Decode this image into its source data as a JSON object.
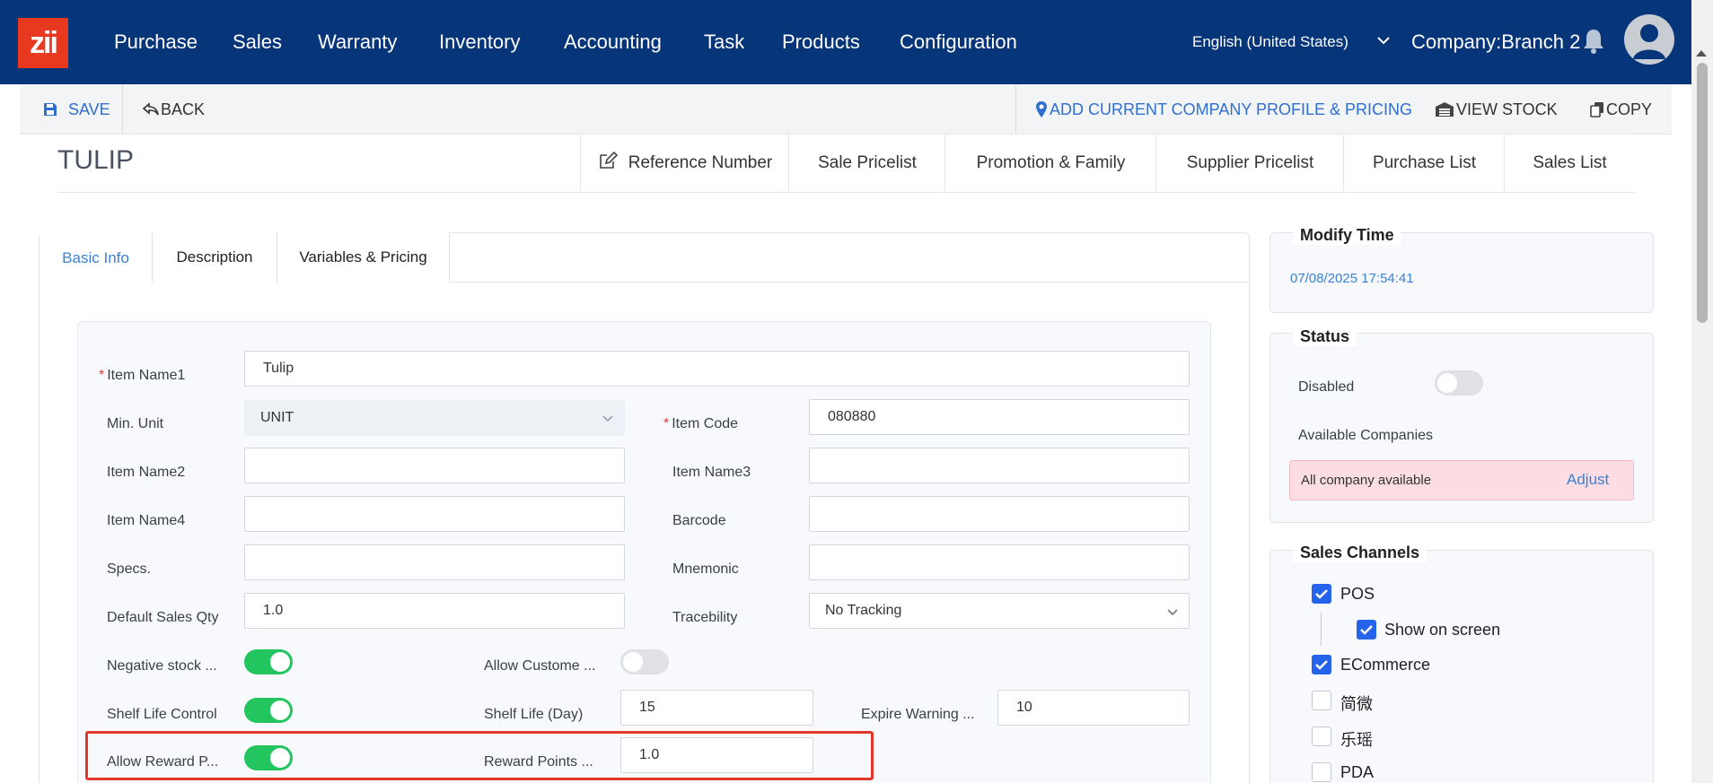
{
  "nav": {
    "logo": "zii",
    "items": [
      "Purchase",
      "Sales",
      "Warranty",
      "Inventory",
      "Accounting",
      "Task",
      "Products",
      "Configuration"
    ],
    "language": "English (United States)",
    "company": "Company:Branch 2"
  },
  "toolbar": {
    "save": "SAVE",
    "back": "BACK",
    "add_profile": "ADD CURRENT COMPANY PROFILE & PRICING",
    "view_stock": "VIEW STOCK",
    "copy": "COPY"
  },
  "page": {
    "title": "TULIP",
    "right_tabs": [
      "Reference Number",
      "Sale Pricelist",
      "Promotion & Family",
      "Supplier Pricelist",
      "Purchase List",
      "Sales List"
    ]
  },
  "tabs": [
    "Basic Info",
    "Description",
    "Variables & Pricing"
  ],
  "form": {
    "item_name1": {
      "label": "Item Name1",
      "value": "Tulip"
    },
    "min_unit": {
      "label": "Min. Unit",
      "value": "UNIT"
    },
    "item_code": {
      "label": "Item Code",
      "value": "080880"
    },
    "item_name2": {
      "label": "Item Name2",
      "value": ""
    },
    "item_name3": {
      "label": "Item Name3",
      "value": ""
    },
    "item_name4": {
      "label": "Item Name4",
      "value": ""
    },
    "barcode": {
      "label": "Barcode",
      "value": ""
    },
    "specs": {
      "label": "Specs.",
      "value": ""
    },
    "mnemonic": {
      "label": "Mnemonic",
      "value": ""
    },
    "default_sales_qty": {
      "label": "Default Sales Qty",
      "value": "1.0"
    },
    "traceability": {
      "label": "Tracebility",
      "value": "No Tracking"
    },
    "negative_stock": {
      "label": "Negative stock ...",
      "on": true
    },
    "allow_customer": {
      "label": "Allow Custome ...",
      "on": false
    },
    "shelf_life_control": {
      "label": "Shelf Life Control",
      "on": true
    },
    "shelf_life_day": {
      "label": "Shelf Life (Day)",
      "value": "15"
    },
    "expire_warning": {
      "label": "Expire Warning ...",
      "value": "10"
    },
    "allow_reward": {
      "label": "Allow Reward P...",
      "on": true
    },
    "reward_points": {
      "label": "Reward Points ...",
      "value": "1.0"
    }
  },
  "modify_time": {
    "title": "Modify Time",
    "value": "07/08/2025 17:54:41"
  },
  "status": {
    "title": "Status",
    "disabled_label": "Disabled",
    "disabled_on": false,
    "available_label": "Available Companies",
    "available_text": "All company available",
    "adjust": "Adjust"
  },
  "sales_channels": {
    "title": "Sales Channels",
    "items": [
      {
        "label": "POS",
        "checked": true
      },
      {
        "label": "Show on screen",
        "checked": true
      },
      {
        "label": "ECommerce",
        "checked": true
      },
      {
        "label": "简微",
        "checked": false
      },
      {
        "label": "乐瑶",
        "checked": false
      },
      {
        "label": "PDA",
        "checked": false
      }
    ]
  },
  "colors": {
    "nav_bg": "#07357a",
    "accent": "#3b82d6",
    "toggle_on": "#22c55e",
    "highlight": "#e1382b"
  }
}
